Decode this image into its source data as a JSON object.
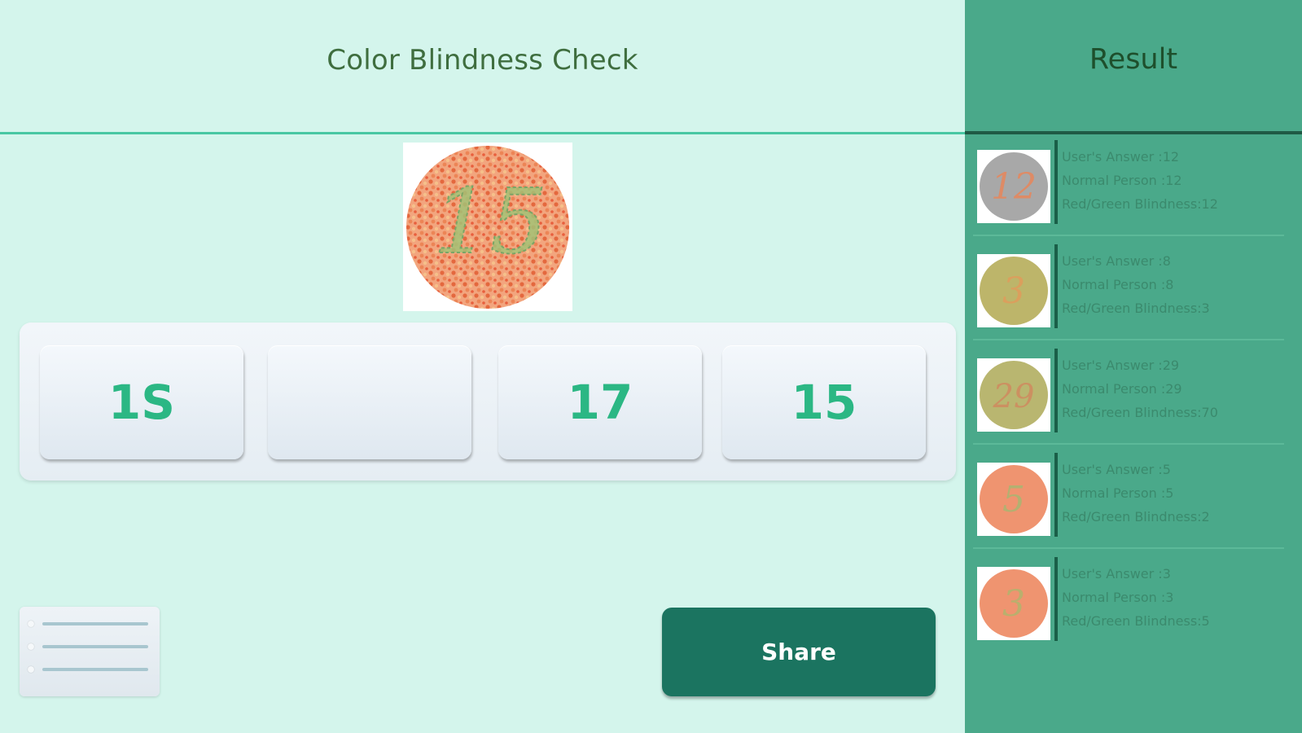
{
  "main": {
    "title": "Color Blindness Check",
    "plate": {
      "number": "15",
      "dots": "#ee8a63",
      "numeral_color": "#9fbf74"
    },
    "options": [
      "1S",
      "",
      "17",
      "15"
    ],
    "menu_icon": "list-icon",
    "share_label": "Share"
  },
  "results": {
    "title": "Result",
    "items": [
      {
        "plate_number": "12",
        "plate_bg": "#a8a8a8",
        "plate_fg": "#e8865a",
        "user": "User's Answer :12",
        "normal": "Normal Person :12",
        "redgreen": "Red/Green Blindness:12"
      },
      {
        "plate_number": "3",
        "plate_bg": "#bdb56a",
        "plate_fg": "#e09b5b",
        "user": "User's Answer :8",
        "normal": "Normal Person :8",
        "redgreen": "Red/Green Blindness:3"
      },
      {
        "plate_number": "29",
        "plate_bg": "#b9b670",
        "plate_fg": "#cf8a5e",
        "user": "User's Answer :29",
        "normal": "Normal Person :29",
        "redgreen": "Red/Green Blindness:70"
      },
      {
        "plate_number": "5",
        "plate_bg": "#ef9470",
        "plate_fg": "#a8b571",
        "user": "User's Answer :5",
        "normal": "Normal Person :5",
        "redgreen": "Red/Green Blindness:2"
      },
      {
        "plate_number": "3",
        "plate_bg": "#ef9470",
        "plate_fg": "#b0b46c",
        "user": "User's Answer :3",
        "normal": "Normal Person :3",
        "redgreen": "Red/Green Blindness:5"
      }
    ]
  }
}
